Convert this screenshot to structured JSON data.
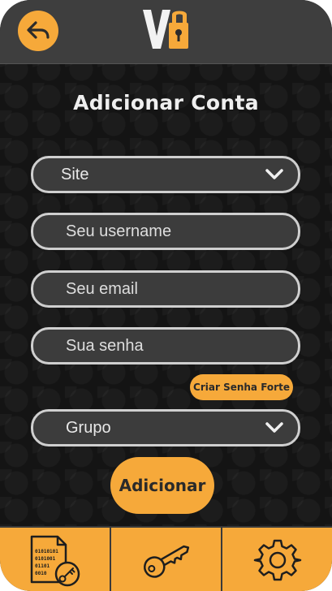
{
  "header": {
    "back_icon": "back-arrow-icon",
    "logo_letters": "VG"
  },
  "page": {
    "title": "Adicionar Conta"
  },
  "form": {
    "site": {
      "value": "Site",
      "icon": "chevron-down-icon"
    },
    "username": {
      "placeholder": "Seu username"
    },
    "email": {
      "placeholder": "Seu email"
    },
    "password": {
      "placeholder": "Sua senha"
    },
    "strong_password_label": "Criar Senha Forte",
    "group": {
      "value": "Grupo",
      "icon": "chevron-down-icon"
    },
    "submit_label": "Adicionar"
  },
  "bottom_nav": {
    "items": [
      {
        "icon": "binary-file-key-icon",
        "binary_lines": [
          "01010101",
          "0101001",
          "01101",
          "0010"
        ]
      },
      {
        "icon": "key-icon"
      },
      {
        "icon": "gear-icon"
      }
    ]
  },
  "colors": {
    "accent": "#f6a93a",
    "background": "#141414",
    "header": "#3e3e3e",
    "field_border": "#cfcfcf"
  }
}
